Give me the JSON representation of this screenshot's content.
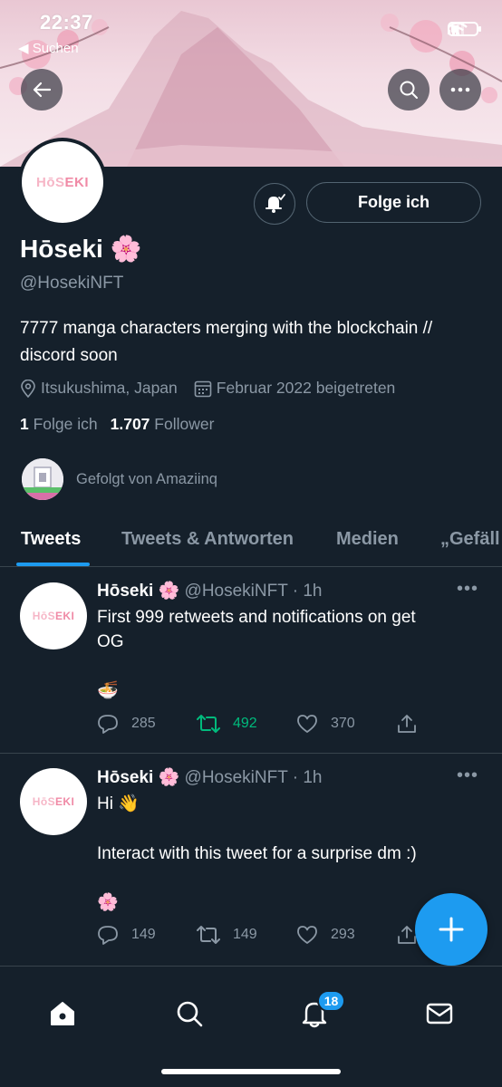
{
  "status_bar": {
    "time": "22:37",
    "back_label": "◀ Suchen"
  },
  "profile": {
    "avatar_text_light": "HōS",
    "avatar_text_bold": "EKI",
    "name": "Hōseki 🌸",
    "handle": "@HosekiNFT",
    "bio": "7777 manga characters merging with the blockchain // discord soon",
    "location": "Itsukushima, Japan",
    "joined": "Februar 2022 beigetreten",
    "following_count": "1",
    "following_label": "Folge ich",
    "followers_count": "1.707",
    "followers_label": "Follower",
    "followed_by": "Gefolgt von Amaziinq",
    "follow_button": "Folge ich"
  },
  "tabs": [
    {
      "label": "Tweets",
      "active": true
    },
    {
      "label": "Tweets & Antworten",
      "active": false
    },
    {
      "label": "Medien",
      "active": false
    },
    {
      "label": "„Gefäll",
      "active": false
    }
  ],
  "tweets": [
    {
      "name": "Hōseki 🌸",
      "handle": "@HosekiNFT · 1h",
      "line1": "First 999 retweets and notifications on get",
      "line2": "OG",
      "line3": "🍜",
      "replies": "285",
      "retweets": "492",
      "likes": "370"
    },
    {
      "name": "Hōseki 🌸",
      "handle": "@HosekiNFT · 1h",
      "line1": "Hi 👋",
      "line2": "Interact with this tweet for a surprise dm :)",
      "line3": "🌸",
      "replies": "149",
      "retweets": "149",
      "likes": "293"
    }
  ],
  "bottom_nav": {
    "notifications_badge": "18"
  },
  "colors": {
    "background": "#15202b",
    "accent": "#1d9bf0",
    "retweet_active": "#00ba7c",
    "muted": "#8b98a5"
  },
  "icons": [
    "back-arrow-icon",
    "search-icon",
    "more-icon",
    "bell-plus-icon",
    "location-icon",
    "calendar-icon",
    "reply-icon",
    "retweet-icon",
    "like-icon",
    "share-icon",
    "compose-plus-icon",
    "home-icon",
    "notifications-icon",
    "messages-icon"
  ]
}
